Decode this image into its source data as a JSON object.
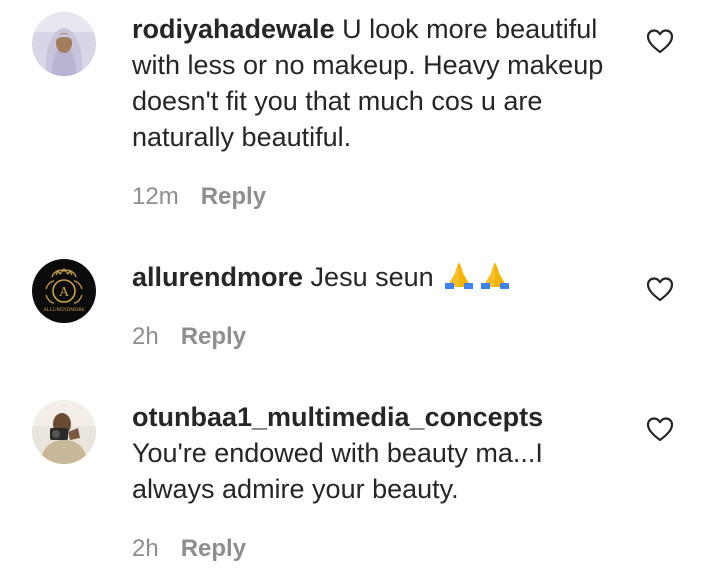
{
  "comments": [
    {
      "username": "rodiyahadewale",
      "text": " U look more beautiful with less or no makeup. Heavy makeup doesn't fit you that much cos u are naturally beautiful.",
      "time": "12m",
      "reply_label": "Reply",
      "avatar_icon": "hijab-person-avatar",
      "like_icon": "heart-outline-icon"
    },
    {
      "username": "allurendmore",
      "text": " Jesu seun ",
      "emoji": "🙏🙏",
      "time": "2h",
      "reply_label": "Reply",
      "avatar_icon": "allurendmore-logo-avatar",
      "avatar_caption": "ALLURENDMORE",
      "avatar_monogram": "A",
      "like_icon": "heart-outline-icon"
    },
    {
      "username": "otunbaa1_multimedia_concepts",
      "text": "You're endowed with beauty ma...I always admire your beauty.",
      "time": "2h",
      "reply_label": "Reply",
      "avatar_icon": "photographer-avatar",
      "like_icon": "heart-outline-icon"
    }
  ],
  "colors": {
    "text": "#262626",
    "muted": "#8e8e8e",
    "gold": "#c9a24a"
  }
}
